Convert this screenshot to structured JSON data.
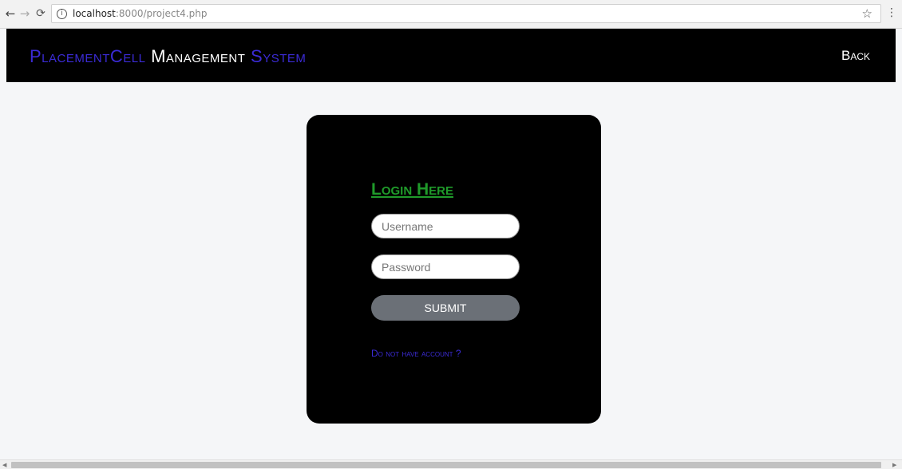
{
  "browser": {
    "url_host": "localhost",
    "url_path": ":8000/project4.php",
    "icons": {
      "back": "arrow-left-icon",
      "forward": "arrow-right-icon",
      "reload": "reload-icon",
      "info": "info-icon",
      "star": "star-icon",
      "menu": "kebab-menu-icon"
    }
  },
  "header": {
    "brand_part1": "PlacementCell",
    "brand_part2": "Management",
    "brand_part3": "System",
    "back_label": "Back"
  },
  "login": {
    "title": "Login Here",
    "username_placeholder": "Username",
    "password_placeholder": "Password",
    "submit_label": "SUBMIT",
    "register_link": "Do not have account ?"
  },
  "colors": {
    "brand_accent": "#3b2bd6",
    "title_green": "#1f9a2a",
    "submit_gray": "#6b7077",
    "card_bg": "#000000"
  }
}
